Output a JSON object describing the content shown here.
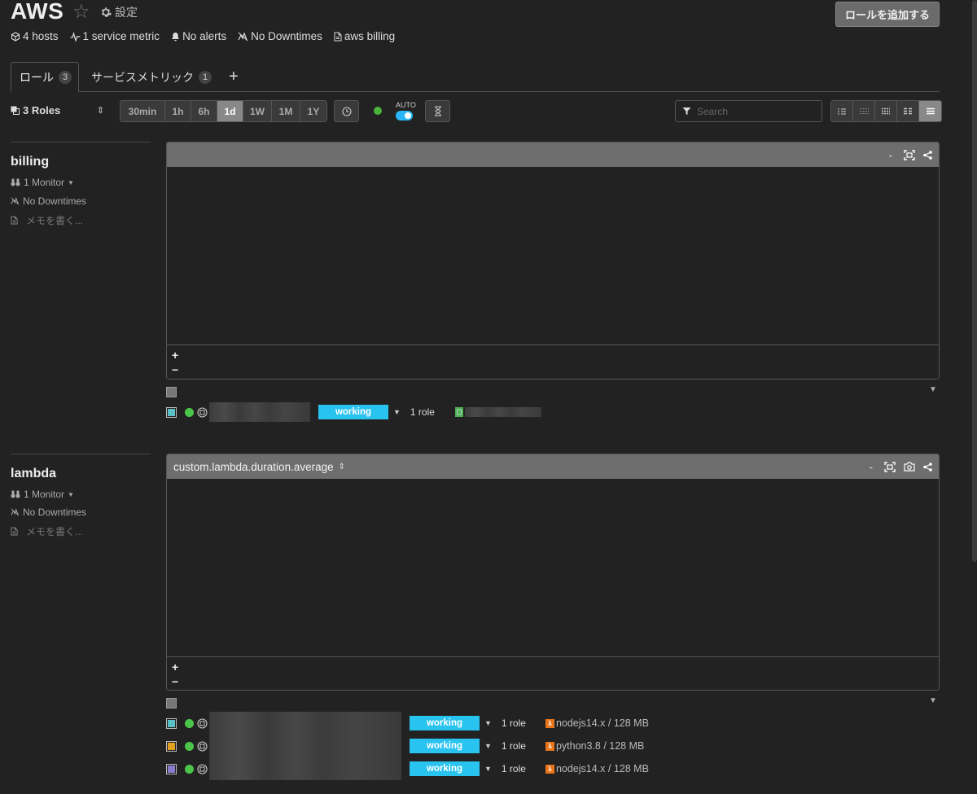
{
  "header": {
    "title": "AWS",
    "settings_label": "設定",
    "add_role_label": "ロールを追加する"
  },
  "summary": {
    "hosts": "4 hosts",
    "service_metric": "1 service metric",
    "alerts": "No alerts",
    "downtimes": "No Downtimes",
    "memo": "aws billing"
  },
  "tabs": [
    {
      "label": "ロール",
      "count": "3"
    },
    {
      "label": "サービスメトリック",
      "count": "1"
    }
  ],
  "toolbar": {
    "roles_label": "3 Roles",
    "ranges": [
      "30min",
      "1h",
      "6h",
      "1d",
      "1W",
      "1M",
      "1Y"
    ],
    "active_range": "1d",
    "auto_label": "AUTO",
    "search_placeholder": "Search"
  },
  "roles": [
    {
      "name": "billing",
      "monitor": "1 Monitor",
      "downtimes": "No Downtimes",
      "memo_placeholder": "メモを書く...",
      "graph_title": "",
      "hosts": [
        {
          "color": "#5bc0c8",
          "status": "working",
          "roles": "1 role",
          "runtime": ""
        }
      ]
    },
    {
      "name": "lambda",
      "monitor": "1 Monitor",
      "downtimes": "No Downtimes",
      "memo_placeholder": "メモを書く...",
      "graph_title": "custom.lambda.duration.average",
      "hosts": [
        {
          "color": "#5bc0c8",
          "status": "working",
          "roles": "1 role",
          "runtime": "nodejs14.x / 128 MB"
        },
        {
          "color": "#e0a020",
          "status": "working",
          "roles": "1 role",
          "runtime": "python3.8 / 128 MB"
        },
        {
          "color": "#8a7ad0",
          "status": "working",
          "roles": "1 role",
          "runtime": "nodejs14.x / 128 MB"
        }
      ]
    }
  ],
  "zoom": {
    "in": "+",
    "out": "−"
  },
  "colors": {
    "accent": "#29c3f0",
    "ok": "#4bc64b",
    "runtime_icon": "#e8751a"
  }
}
